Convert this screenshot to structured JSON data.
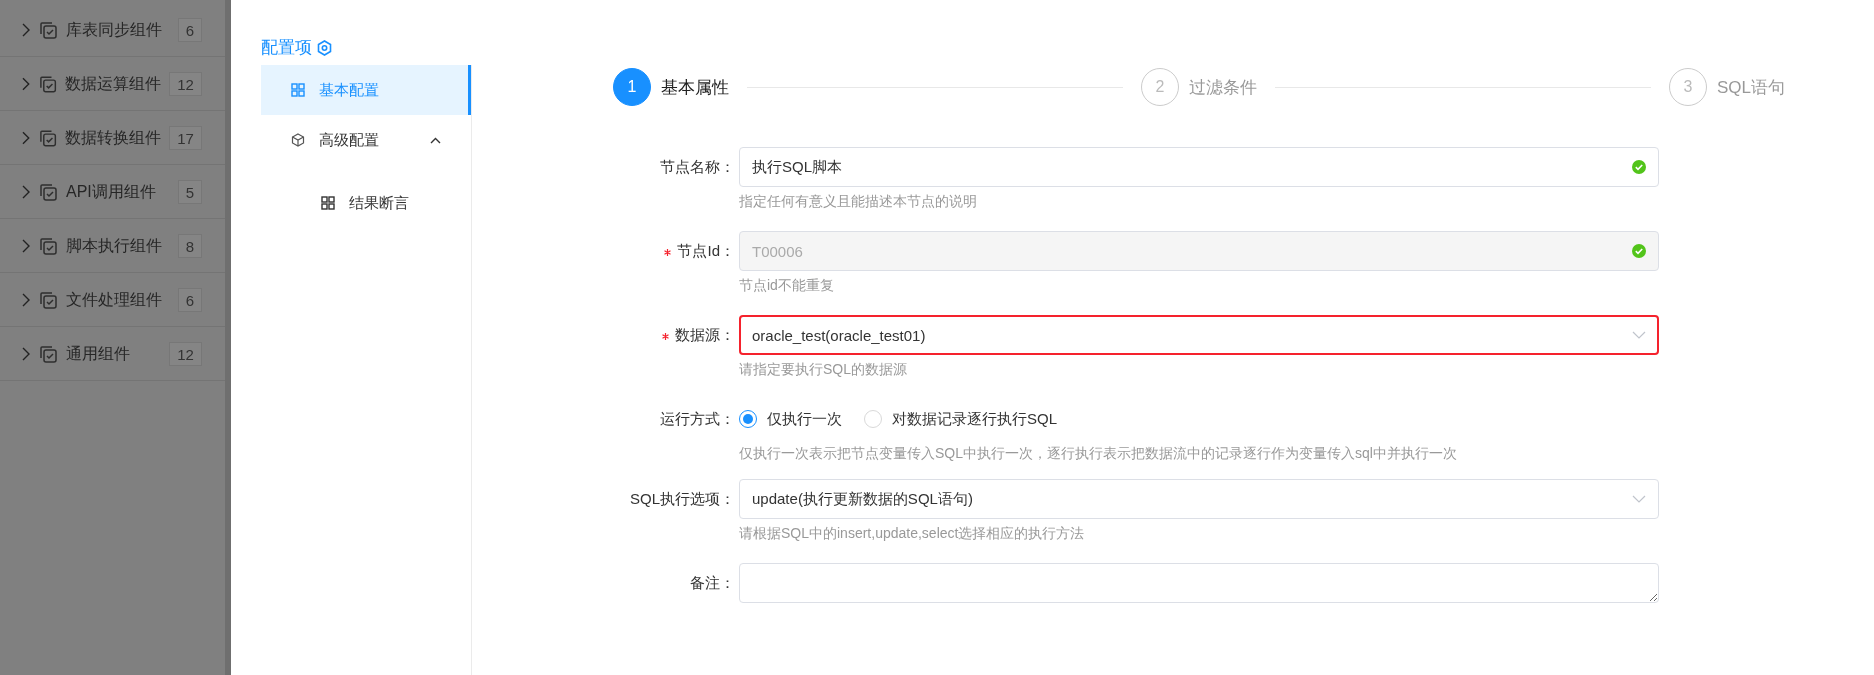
{
  "sidebar": {
    "items": [
      {
        "label": "库表同步组件",
        "count": "6"
      },
      {
        "label": "数据运算组件",
        "count": "12"
      },
      {
        "label": "数据转换组件",
        "count": "17"
      },
      {
        "label": "API调用组件",
        "count": "5"
      },
      {
        "label": "脚本执行组件",
        "count": "8"
      },
      {
        "label": "文件处理组件",
        "count": "6"
      },
      {
        "label": "通用组件",
        "count": "12"
      }
    ]
  },
  "config_panel": {
    "title": "配置项",
    "items": [
      {
        "label": "基本配置",
        "selected": true
      },
      {
        "label": "高级配置",
        "selected": false,
        "expanded": true,
        "children": [
          {
            "label": "结果断言",
            "selected": false
          }
        ]
      }
    ]
  },
  "steps": [
    {
      "number": "1",
      "label": "基本属性",
      "active": true
    },
    {
      "number": "2",
      "label": "过滤条件",
      "active": false
    },
    {
      "number": "3",
      "label": "SQL语句",
      "active": false
    }
  ],
  "form": {
    "fields": [
      {
        "kind": "input",
        "label": "节点名称：",
        "required": false,
        "value": "执行SQL脚本",
        "disabled": false,
        "valid": true,
        "help": "指定任何有意义且能描述本节点的说明"
      },
      {
        "kind": "input",
        "label": "节点Id：",
        "required": true,
        "value": "T00006",
        "disabled": true,
        "valid": true,
        "help": "节点id不能重复"
      },
      {
        "kind": "select",
        "label": "数据源：",
        "required": true,
        "value": "oracle_test(oracle_test01)",
        "highlighted": true,
        "help": "请指定要执行SQL的数据源"
      },
      {
        "kind": "radio",
        "label": "运行方式：",
        "required": false,
        "options": [
          {
            "label": "仅执行一次",
            "selected": true
          },
          {
            "label": "对数据记录逐行执行SQL",
            "selected": false
          }
        ],
        "help": "仅执行一次表示把节点变量传入SQL中执行一次，逐行执行表示把数据流中的记录逐行作为变量传入sql中并执行一次"
      },
      {
        "kind": "select",
        "label": "SQL执行选项：",
        "required": false,
        "value": "update(执行更新数据的SQL语句)",
        "highlighted": false,
        "help": "请根据SQL中的insert,update,select选择相应的执行方法"
      },
      {
        "kind": "textarea",
        "label": "备注：",
        "required": false
      }
    ]
  }
}
